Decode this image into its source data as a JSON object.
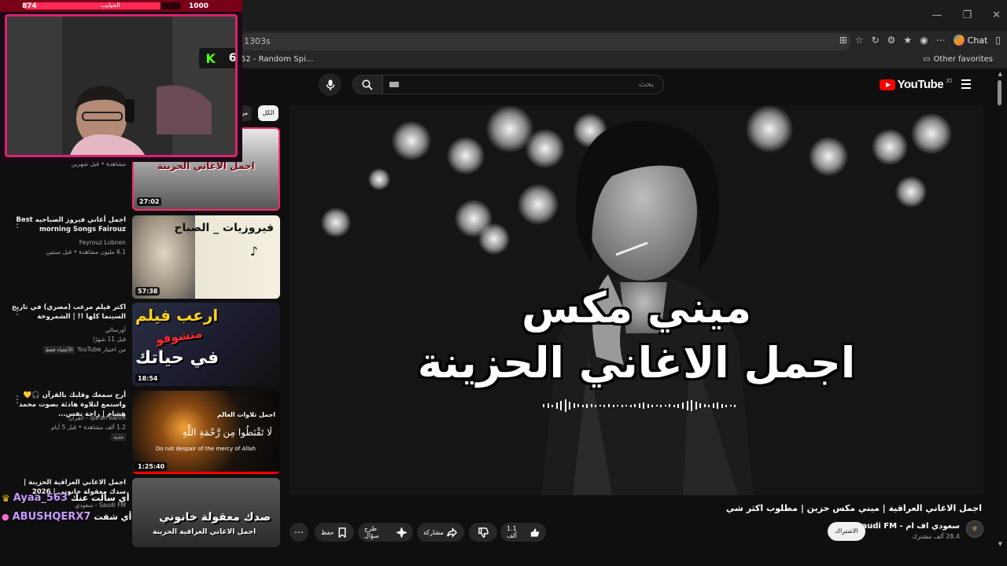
{
  "browser": {
    "url": "1303s",
    "bookmark": "52 - Random Spi...",
    "other_favorites": "Other favorites",
    "chat_label": "Chat"
  },
  "youtube": {
    "logo": "YouTube",
    "region": "JO",
    "search_placeholder": "بحث"
  },
  "player": {
    "title_line1": "ميني مكس",
    "title_line2": "اجمل الاغاني الحزينة"
  },
  "video": {
    "title": "اجمل الاغاني العراقية | ميني مكس حزين | مطلوب اكثر شي",
    "channel": "سعودي اف ام - Saudi FM",
    "subscribers": "28.4 ألف مشترك",
    "subscribe": "الاشتراك",
    "likes": "1.1 ألف",
    "share": "مشاركة",
    "ask": "طرح سؤال",
    "save": "حفظ"
  },
  "chips": {
    "all": "الكل",
    "from": "من"
  },
  "recommendations": [
    {
      "duration": "27:02",
      "thumb_text": "اجمل الاغاني الحزينة",
      "meta": "مشاهدة • قبل شهرين"
    },
    {
      "title": "اجمل أغاني فيروز الصباحيه Best morning Songs Fairouz",
      "channel": "Feyrouz Lubnen",
      "meta": "6.1 مليون مشاهدة • قبل سنتين",
      "duration": "57:38",
      "thumb_text": "فيروزيات _ الصباح"
    },
    {
      "title": "اكتر فيلم مرعب (مصري) في تاريخ السينما كلها !! | الشمروخة",
      "channel": "أورسالي",
      "meta": "قبل 11 شهرًا",
      "tag": "من اختيار YouTube",
      "tag2": "الأعضاء فقط",
      "duration": "18:54",
      "thumb_line1": "ارعب فيلم",
      "thumb_line2": "متشوفو",
      "thumb_line3": "في حياتك"
    },
    {
      "title": "أرح سمعك وقلبك بالقرآن 🎧💛 واستمع لتلاوة هادئة بصوت محمد هشام | راحة نفس...",
      "channel": "quran karim - القرآن",
      "meta": "1.2 ألف مشاهدة • قبل 5 أيام",
      "badge": "جديد",
      "duration": "1:25:40",
      "thumb_title": "اجمل تلاوات العالم",
      "thumb_ar": "لَا تَقْنَطُوا مِن رَّحْمَةِ اللَّهِ",
      "thumb_en": "Do not despair of the mercy of Allah"
    },
    {
      "title": "اجمل الاغاني العراقية الحزينة | سدك معقولة خانوني | 2026",
      "channel": "Saudi FM - سعودي",
      "thumb_line1": "صدك معقولة خانوني",
      "thumb_line2": "اجمل الاغاني العراقية الحزينة"
    }
  ],
  "overlay": {
    "hp_left": "874",
    "hp_name": "الحبايب",
    "hp_right": "1000",
    "kick_count": "6",
    "kick_letter": "K",
    "chat": [
      {
        "user": "Ayaa_563",
        "text": "أي سألت عنك"
      },
      {
        "user": "ABUSHQERX7",
        "text": "أي شفت"
      }
    ]
  }
}
